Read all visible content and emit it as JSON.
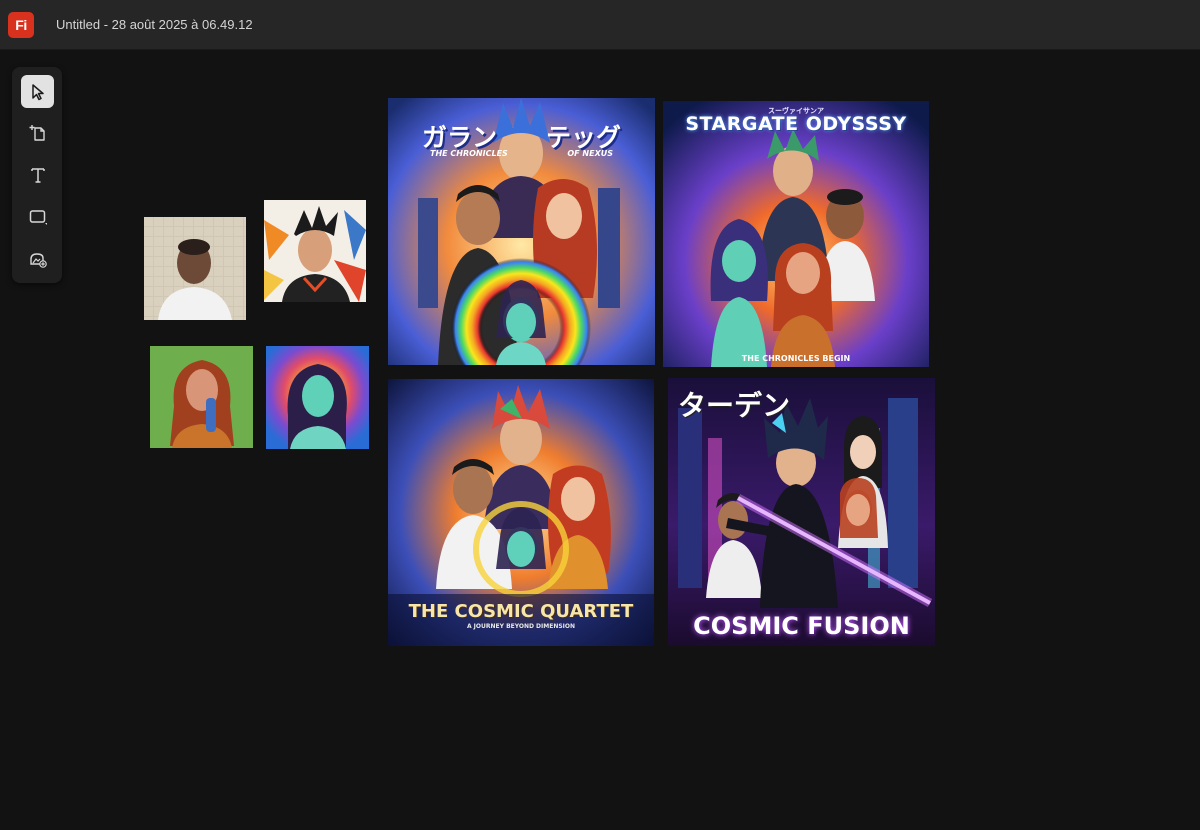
{
  "app": {
    "logo_text": "Fi",
    "logo_color": "#d8321f"
  },
  "document": {
    "title": "Untitled - 28 août 2025 à 06.49.12"
  },
  "toolbar": {
    "tools": [
      {
        "name": "select",
        "icon": "pointer-arrow-icon",
        "active": true
      },
      {
        "name": "generate-image",
        "icon": "add-page-icon",
        "active": false
      },
      {
        "name": "text",
        "icon": "text-T-icon",
        "active": false
      },
      {
        "name": "shape",
        "icon": "rectangle-shape-icon",
        "active": false
      },
      {
        "name": "image-edit",
        "icon": "image-sparkle-icon",
        "active": false
      }
    ]
  },
  "canvas": {
    "source_photos": [
      {
        "id": "photo-man",
        "description_icon": "portrait-photo"
      },
      {
        "id": "photo-stylized-man",
        "description_icon": "portrait-illustration"
      },
      {
        "id": "photo-woman-red-hair",
        "description_icon": "portrait-photo"
      },
      {
        "id": "photo-stylized-girl",
        "description_icon": "portrait-illustration"
      }
    ],
    "posters": [
      {
        "id": "poster-1",
        "title_jp_left": "ガラン",
        "title_jp_right": "テッグ",
        "subtitle_left": "THE CHRONICLES",
        "subtitle_right": "OF NEXUS"
      },
      {
        "id": "poster-2",
        "kana": "スーヴァイサンア",
        "title": "STARGATE ODYSSSY",
        "subtitle": "THE CHRONICLES BEGIN"
      },
      {
        "id": "poster-3",
        "title": "THE COSMIC QUARTET",
        "subtitle": "A JOURNEY BEYOND DIMENSION"
      },
      {
        "id": "poster-4",
        "title_jp": "ターデン",
        "title": "COSMIC FUSION"
      }
    ]
  }
}
